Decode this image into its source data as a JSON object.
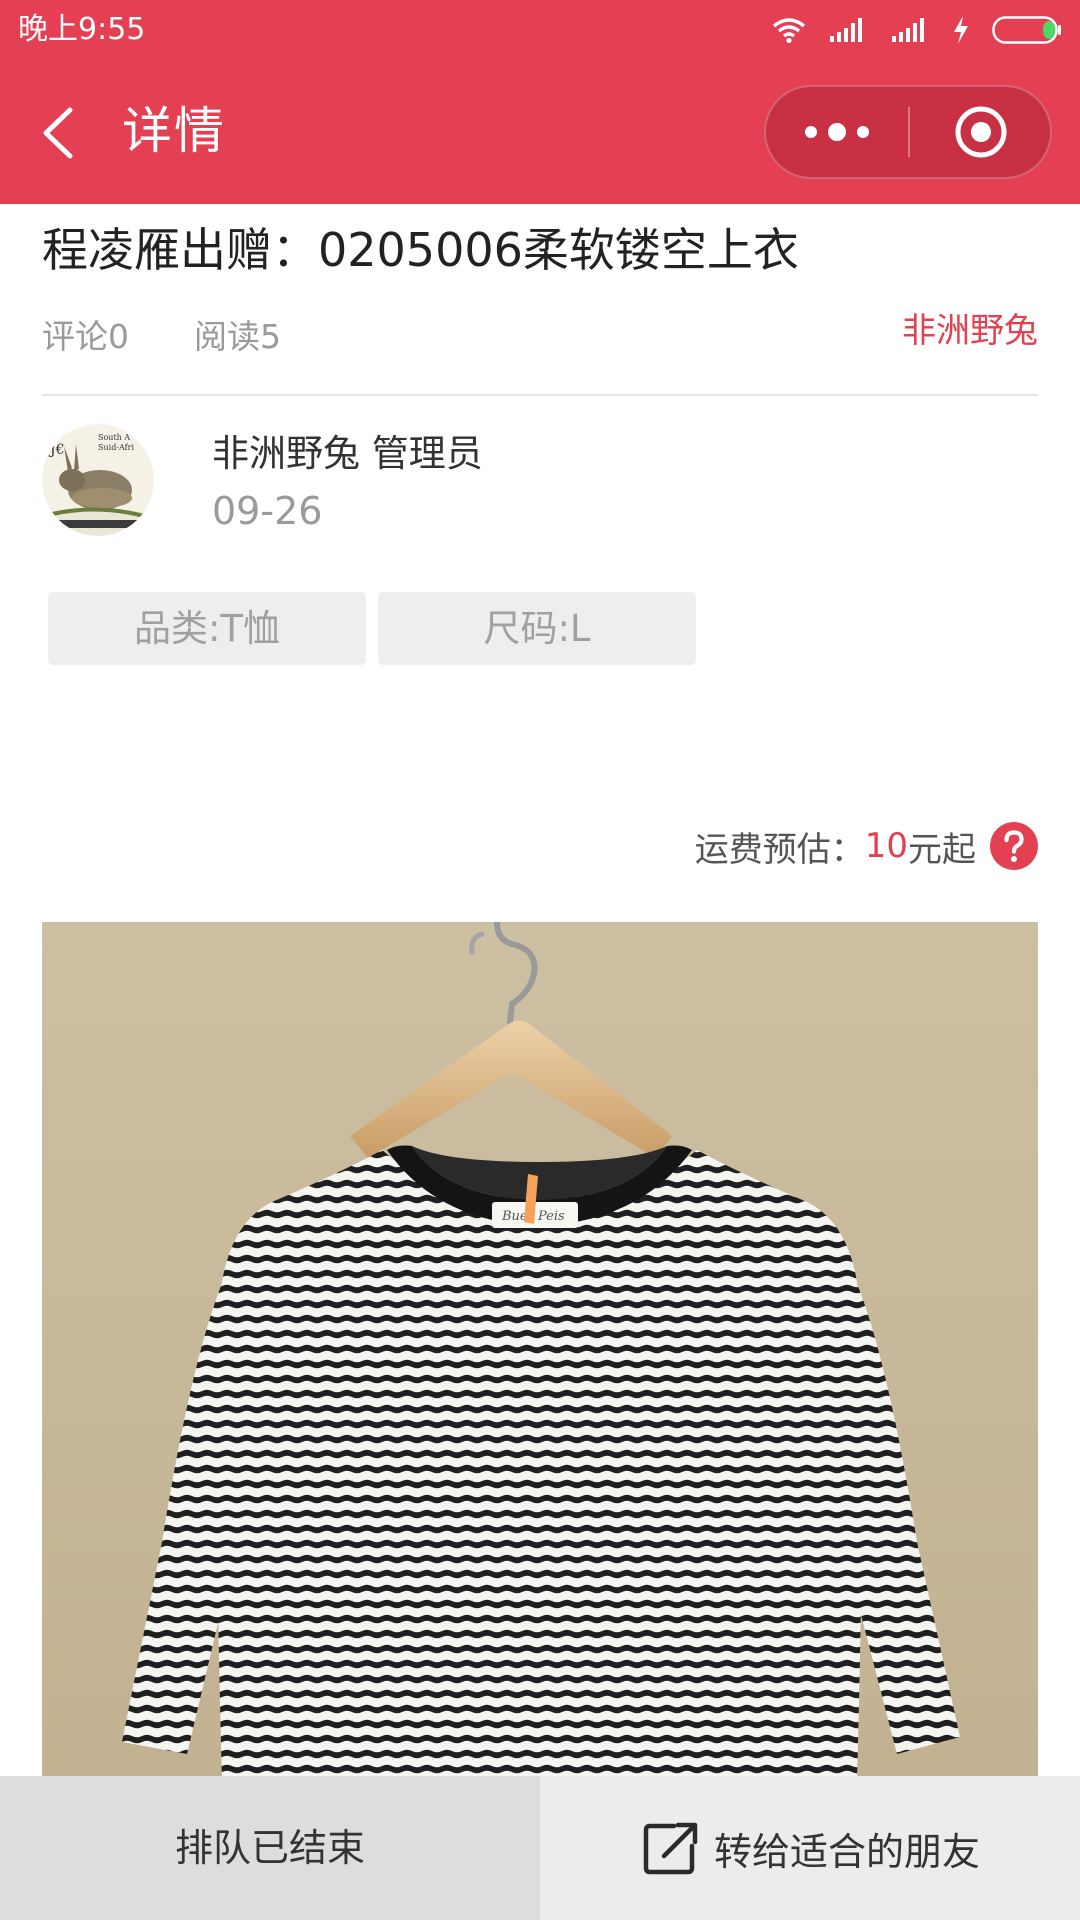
{
  "status_bar": {
    "time": "晚上9:55",
    "icons": [
      "wifi-icon",
      "signal-icon",
      "signal-icon",
      "charging-icon",
      "battery-icon"
    ]
  },
  "nav": {
    "title": "详情",
    "icons": [
      "back-arrow-icon",
      "more-dots-icon",
      "close-target-icon"
    ]
  },
  "post": {
    "title": "程凌雁出赠：0205006柔软镂空上衣",
    "comments": "评论0",
    "reads": "阅读5",
    "author_link": "非洲野兔",
    "author_line": "非洲野兔 管理员",
    "date": "09-26",
    "tags": [
      "品类:T恤",
      "尺码:L"
    ]
  },
  "shipping": {
    "label": "运费预估：",
    "price": "10",
    "suffix": "元起",
    "icon": "help-icon"
  },
  "bottom_bar": {
    "queue_label": "排队已结束",
    "share_label": "转给适合的朋友",
    "share_icon": "share-external-icon"
  },
  "colors": {
    "brand_red": "#e43f53",
    "accent_red": "#e34152",
    "tag_bg": "#eeeeee",
    "photo_bg": "#c8b89a"
  }
}
